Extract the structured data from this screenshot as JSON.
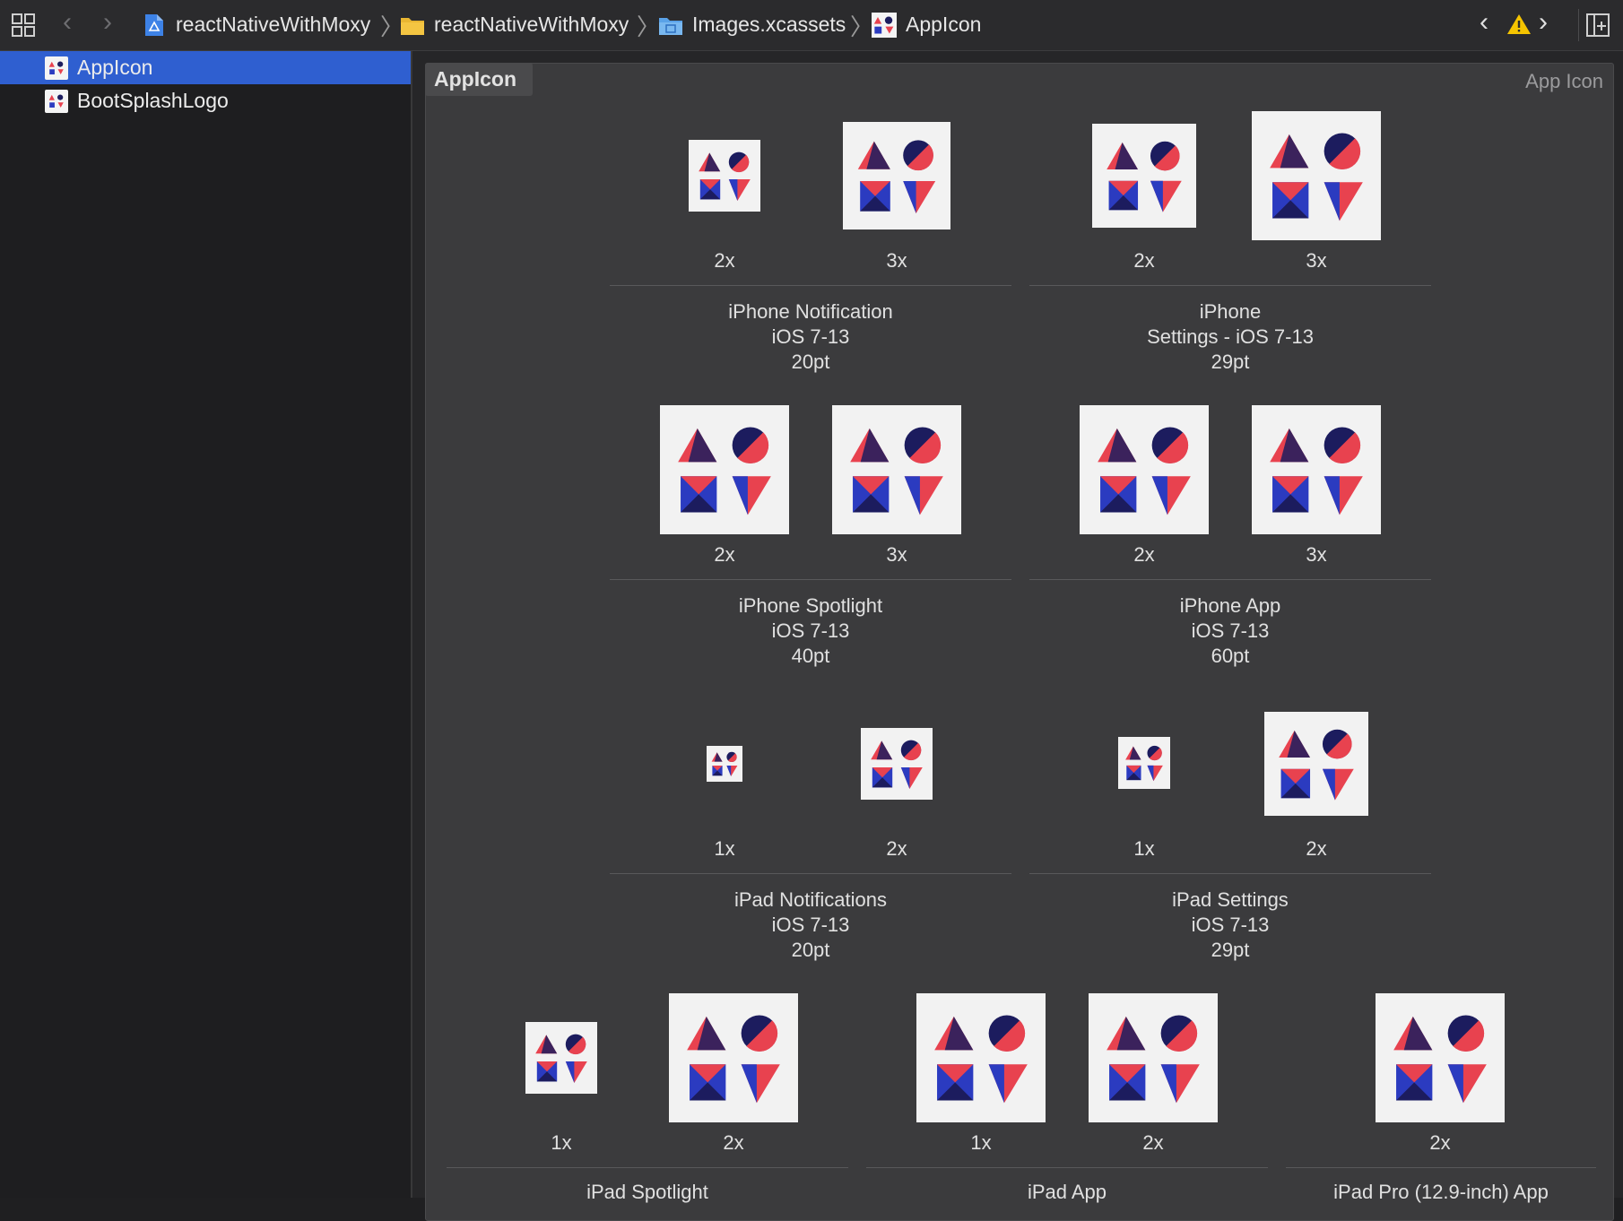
{
  "toolbar": {
    "grid_icon": "grid-icon",
    "back_icon": "chevron-left-icon",
    "forward_icon": "chevron-right-icon",
    "breadcrumbs": [
      {
        "label": "reactNativeWithMoxy",
        "icon": "project-icon"
      },
      {
        "label": "reactNativeWithMoxy",
        "icon": "folder-icon"
      },
      {
        "label": "Images.xcassets",
        "icon": "asset-folder-icon"
      },
      {
        "label": "AppIcon",
        "icon": "appicon-icon"
      }
    ],
    "issue_prev_icon": "chevron-left-icon",
    "warning_icon": "warning-icon",
    "issue_next_icon": "chevron-right-icon",
    "add_editor_icon": "add-editor-icon"
  },
  "sidebar": {
    "items": [
      {
        "label": "AppIcon",
        "selected": true
      },
      {
        "label": "BootSplashLogo",
        "selected": false
      }
    ]
  },
  "panel": {
    "tab_label": "AppIcon",
    "type_label": "App Icon",
    "groups": [
      {
        "slots": [
          "2x",
          "3x"
        ],
        "lines": [
          "iPhone Notification",
          "iOS 7-13",
          "20pt"
        ]
      },
      {
        "slots": [
          "2x",
          "3x"
        ],
        "lines": [
          "iPhone",
          "Settings - iOS 7-13",
          "29pt"
        ]
      },
      {
        "slots": [
          "2x",
          "3x"
        ],
        "lines": [
          "iPhone Spotlight",
          "iOS 7-13",
          "40pt"
        ]
      },
      {
        "slots": [
          "2x",
          "3x"
        ],
        "lines": [
          "iPhone App",
          "iOS 7-13",
          "60pt"
        ]
      },
      {
        "slots": [
          "1x",
          "2x"
        ],
        "lines": [
          "iPad Notifications",
          "iOS 7-13",
          "20pt"
        ]
      },
      {
        "slots": [
          "1x",
          "2x"
        ],
        "lines": [
          "iPad Settings",
          "iOS 7-13",
          "29pt"
        ]
      },
      {
        "slots": [
          "1x",
          "2x"
        ],
        "lines": [
          "iPad Spotlight"
        ]
      },
      {
        "slots": [
          "1x",
          "2x"
        ],
        "lines": [
          "iPad App"
        ]
      },
      {
        "slots": [
          "2x"
        ],
        "lines": [
          "iPad Pro (12.9-inch) App"
        ]
      }
    ]
  },
  "colors": {
    "selection": "#2f5fd0",
    "icon_red": "#e8424f",
    "icon_navy": "#1c1c5e",
    "icon_blue": "#2b3bc0",
    "warning": "#f5c400"
  }
}
